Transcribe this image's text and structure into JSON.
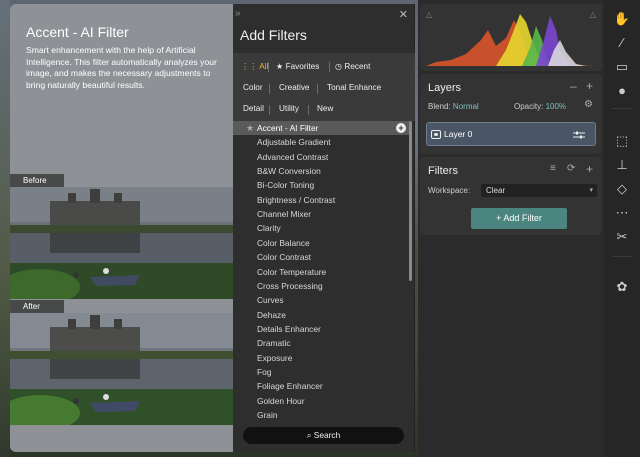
{
  "info": {
    "title": "Accent - AI Filter",
    "description": "Smart enhancement with the help of Artificial Intelligence. This filter automatically analyzes your image, and makes the necessary adjustments to bring naturally beautiful results.",
    "before_label": "Before",
    "after_label": "After"
  },
  "popup": {
    "title": "Add Filters",
    "collapse_icon": "double-chevron-right-icon",
    "close_icon": "close-icon",
    "chips": [
      {
        "label": "All",
        "icon": "grid-icon",
        "active": true
      },
      {
        "label": "Favorites",
        "icon": "star-icon",
        "active": false
      },
      {
        "label": "Recent",
        "icon": "clock-icon",
        "active": false
      },
      {
        "label": "Color",
        "active": false
      },
      {
        "label": "Creative",
        "active": false
      },
      {
        "label": "Tonal Enhance",
        "active": false
      },
      {
        "label": "Detail",
        "active": false
      },
      {
        "label": "Utility",
        "active": false
      },
      {
        "label": "New",
        "active": false
      }
    ],
    "filters": [
      "Accent - AI Filter",
      "Adjustable Gradient",
      "Advanced Contrast",
      "B&W Conversion",
      "Bi-Color Toning",
      "Brightness / Contrast",
      "Channel Mixer",
      "Clarity",
      "Color Balance",
      "Color Contrast",
      "Color Temperature",
      "Cross Processing",
      "Curves",
      "Dehaze",
      "Details Enhancer",
      "Dramatic",
      "Exposure",
      "Fog",
      "Foliage Enhancer",
      "Golden Hour",
      "Grain"
    ],
    "selected_index": 0,
    "search_label": "Search"
  },
  "layers": {
    "title": "Layers",
    "blend_label": "Blend:",
    "blend_value": "Normal",
    "opacity_label": "Opacity:",
    "opacity_value": "100%",
    "layer_name": "Layer 0"
  },
  "filters_panel": {
    "title": "Filters",
    "workspace_label": "Workspace:",
    "workspace_value": "Clear",
    "add_button": "Add Filter"
  },
  "colors": {
    "accent": "#f0b03a",
    "teal_button": "#4b8580",
    "layer_selected": "#4a5666"
  }
}
